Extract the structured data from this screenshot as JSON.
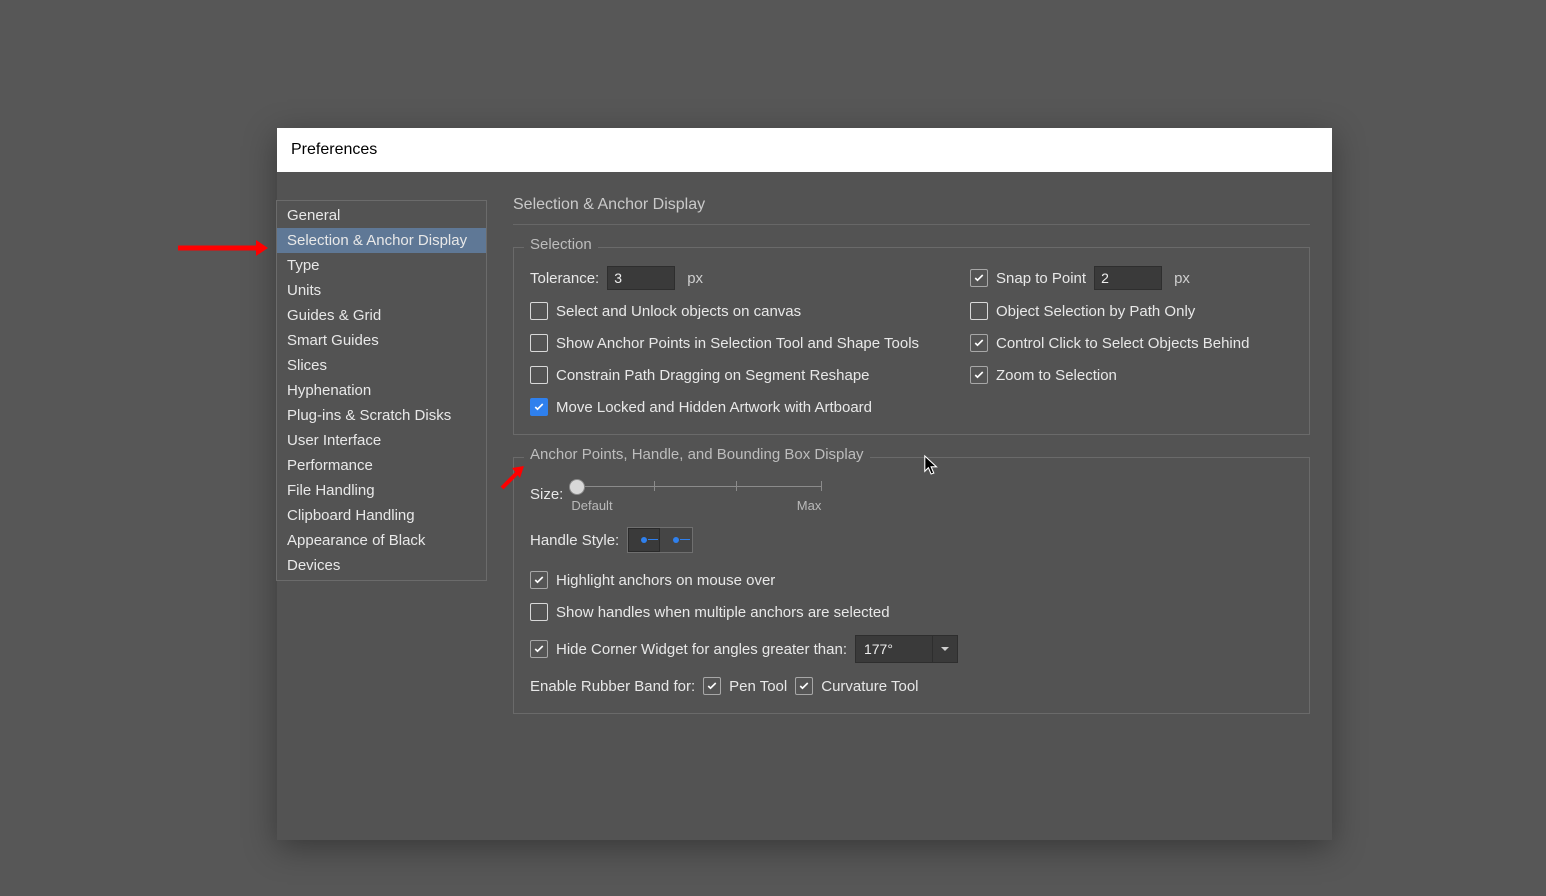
{
  "dialog": {
    "title": "Preferences"
  },
  "sidebar": {
    "items": [
      "General",
      "Selection & Anchor Display",
      "Type",
      "Units",
      "Guides & Grid",
      "Smart Guides",
      "Slices",
      "Hyphenation",
      "Plug-ins & Scratch Disks",
      "User Interface",
      "Performance",
      "File Handling",
      "Clipboard Handling",
      "Appearance of Black",
      "Devices"
    ],
    "selected_index": 1
  },
  "main": {
    "title": "Selection & Anchor Display",
    "selection_group": {
      "legend": "Selection",
      "tolerance_label": "Tolerance:",
      "tolerance_value": "3",
      "tolerance_unit": "px",
      "snap_label": "Snap to Point",
      "snap_checked": true,
      "snap_value": "2",
      "snap_unit": "px",
      "left_checks": [
        {
          "label": "Select and Unlock objects on canvas",
          "checked": false
        },
        {
          "label": "Show Anchor Points in Selection Tool and Shape Tools",
          "checked": false
        },
        {
          "label": "Constrain Path Dragging on Segment Reshape",
          "checked": false
        },
        {
          "label": "Move Locked and Hidden Artwork with Artboard",
          "checked": true
        }
      ],
      "right_checks": [
        {
          "label": "Object Selection by Path Only",
          "checked": false
        },
        {
          "label": "Control Click to Select Objects Behind",
          "checked": true
        },
        {
          "label": "Zoom to Selection",
          "checked": true
        }
      ]
    },
    "anchor_group": {
      "legend": "Anchor Points, Handle, and Bounding Box Display",
      "size_label": "Size:",
      "size_min": "Default",
      "size_max": "Max",
      "handle_style_label": "Handle Style:",
      "highlight": {
        "label": "Highlight anchors on mouse over",
        "checked": true
      },
      "show_handles": {
        "label": "Show handles when multiple anchors are selected",
        "checked": false
      },
      "hide_corner": {
        "label": "Hide Corner Widget for angles greater than:",
        "checked": true,
        "value": "177°"
      },
      "rubber_band_label": "Enable Rubber Band for:",
      "pen": {
        "label": "Pen Tool",
        "checked": true
      },
      "curv": {
        "label": "Curvature Tool",
        "checked": true
      }
    }
  }
}
